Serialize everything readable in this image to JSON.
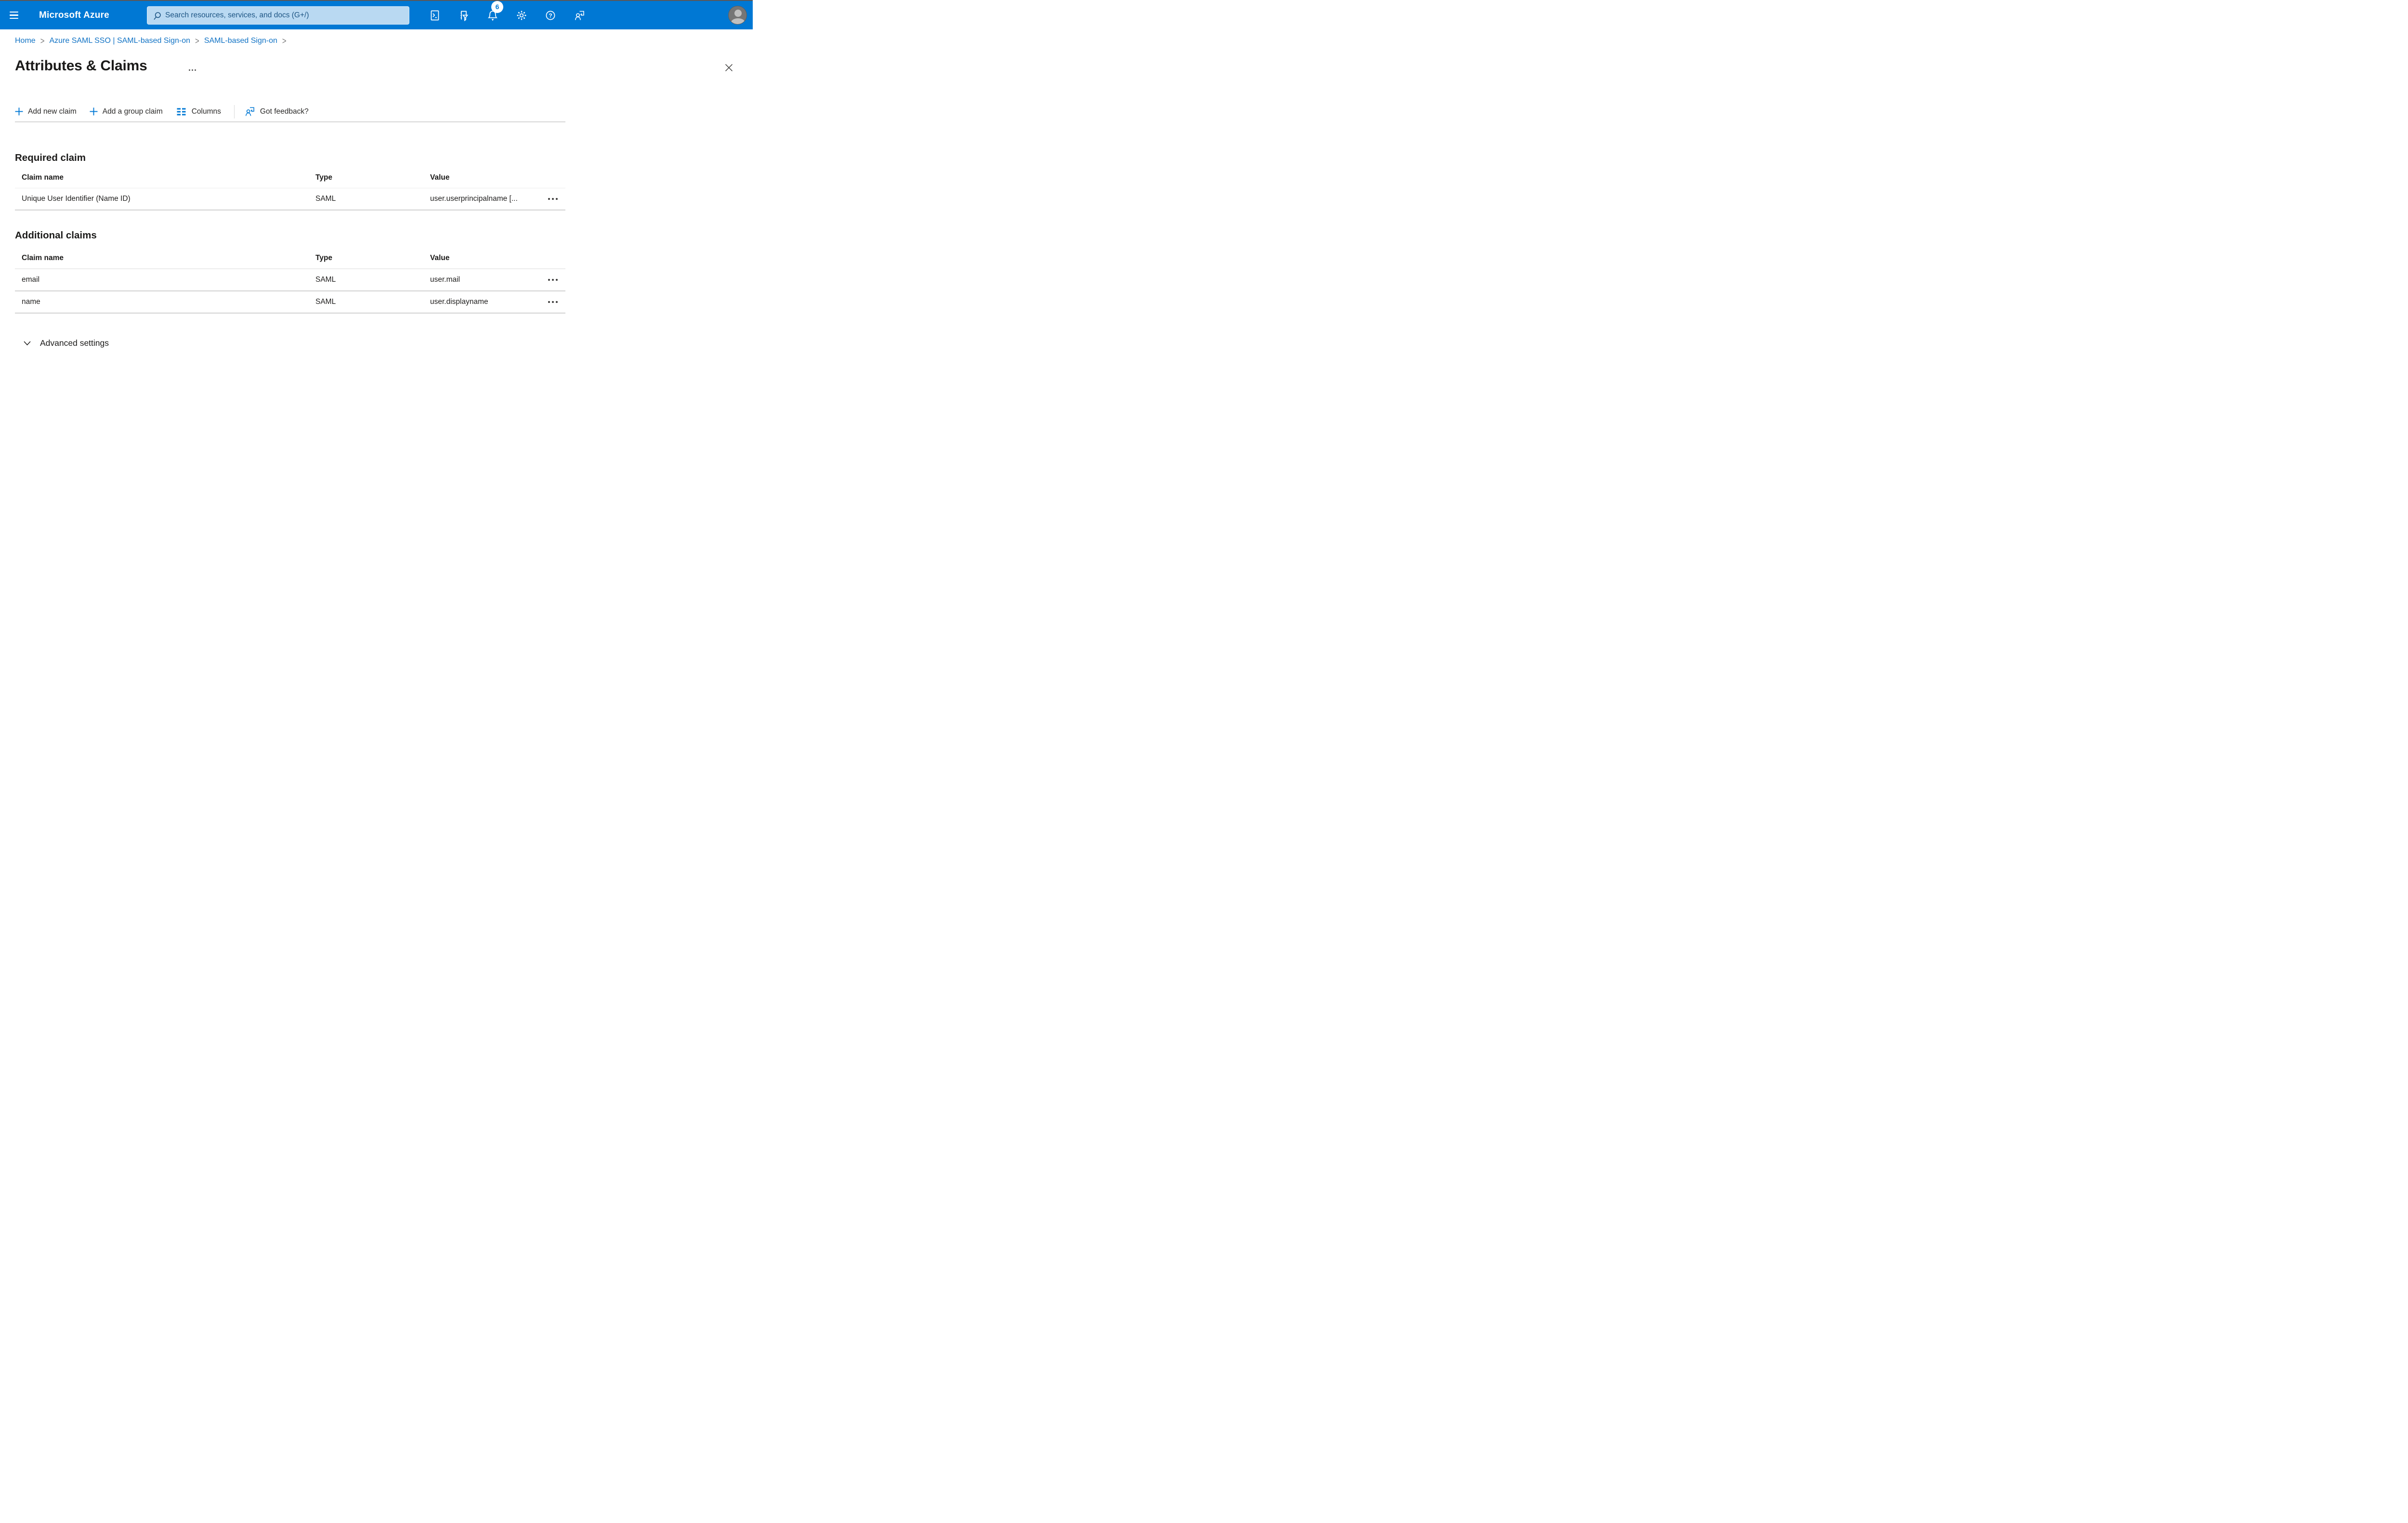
{
  "topbar": {
    "brand": "Microsoft Azure",
    "search": {
      "placeholder": "Search resources, services, and docs (G+/)"
    },
    "notifications_badge": "6",
    "colors": {
      "bar": "#0078d4",
      "search_bg": "#b9d9f2"
    }
  },
  "breadcrumb": {
    "separator": ">",
    "items": [
      {
        "label": "Home"
      },
      {
        "label": "Azure SAML SSO | SAML-based Sign-on"
      },
      {
        "label": "SAML-based Sign-on"
      }
    ]
  },
  "page": {
    "title": "Attributes & Claims"
  },
  "toolbar": {
    "add_new_claim": "Add new claim",
    "add_group_claim": "Add a group claim",
    "columns": "Columns",
    "got_feedback": "Got feedback?"
  },
  "required_claim": {
    "heading": "Required claim",
    "headers": {
      "claim_name": "Claim name",
      "type": "Type",
      "value": "Value"
    },
    "rows": [
      {
        "claim_name": "Unique User Identifier (Name ID)",
        "type": "SAML",
        "value": "user.userprincipalname [..."
      }
    ]
  },
  "additional_claims": {
    "heading": "Additional claims",
    "headers": {
      "claim_name": "Claim name",
      "type": "Type",
      "value": "Value"
    },
    "rows": [
      {
        "claim_name": "email",
        "type": "SAML",
        "value": "user.mail"
      },
      {
        "claim_name": "name",
        "type": "SAML",
        "value": "user.displayname"
      }
    ]
  },
  "advanced_settings": {
    "label": "Advanced settings"
  },
  "accent": {
    "primary": "#0078d4",
    "link": "#1173c5"
  }
}
